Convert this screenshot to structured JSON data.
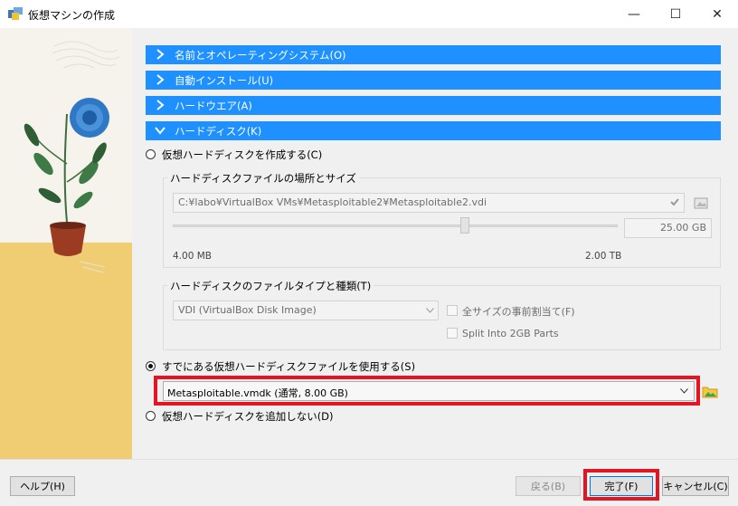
{
  "window": {
    "title": "仮想マシンの作成",
    "controls": {
      "minimize": "—",
      "maximize": "☐",
      "close": "✕"
    }
  },
  "sections": [
    {
      "label": "名前とオペレーティングシステム(O)",
      "expanded": false
    },
    {
      "label": "自動インストール(U)",
      "expanded": false
    },
    {
      "label": "ハードウエア(A)",
      "expanded": false
    },
    {
      "label": "ハードディスク(K)",
      "expanded": true
    }
  ],
  "disk": {
    "create_option": {
      "label": "仮想ハードディスクを作成する(C)",
      "selected": false
    },
    "location_group": {
      "title": "ハードディスクファイルの場所とサイズ",
      "path": "C:¥labo¥VirtualBox VMs¥Metasploitable2¥Metasploitable2.vdi",
      "size_value": "25.00 GB",
      "min_label": "4.00 MB",
      "max_label": "2.00 TB",
      "slider_fraction": 0.66
    },
    "type_group": {
      "title": "ハードディスクのファイルタイプと種類(T)",
      "type_value": "VDI (VirtualBox Disk Image)",
      "preallocate_label": "全サイズの事前割当て(F)",
      "split_label": "Split Into 2GB Parts"
    },
    "existing_option": {
      "label": "すでにある仮想ハードディスクファイルを使用する(S)",
      "selected": true
    },
    "existing_value": "Metasploitable.vmdk (通常, 8.00 GB)",
    "none_option": {
      "label": "仮想ハードディスクを追加しない(D)",
      "selected": false
    }
  },
  "footer": {
    "help": "ヘルプ(H)",
    "back": "戻る(B)",
    "finish": "完了(F)",
    "cancel": "キャンセル(C)"
  },
  "colors": {
    "section_blue": "#1e90ff",
    "highlight_red": "#e51423"
  }
}
